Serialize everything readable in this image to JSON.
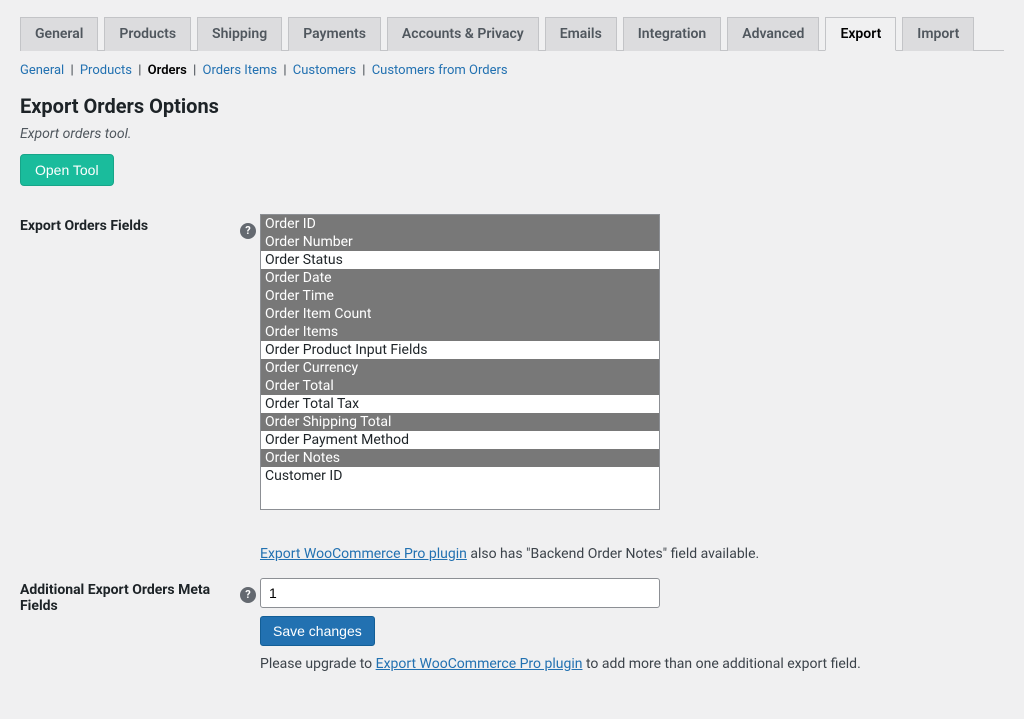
{
  "tabs": [
    {
      "label": "General"
    },
    {
      "label": "Products"
    },
    {
      "label": "Shipping"
    },
    {
      "label": "Payments"
    },
    {
      "label": "Accounts & Privacy"
    },
    {
      "label": "Emails"
    },
    {
      "label": "Integration"
    },
    {
      "label": "Advanced"
    },
    {
      "label": "Export",
      "active": true
    },
    {
      "label": "Import"
    }
  ],
  "subnav": {
    "items": [
      {
        "label": "General"
      },
      {
        "label": "Products"
      },
      {
        "label": "Orders",
        "current": true
      },
      {
        "label": "Orders Items"
      },
      {
        "label": "Customers"
      },
      {
        "label": "Customers from Orders"
      }
    ]
  },
  "heading": "Export Orders Options",
  "heading_desc": "Export orders tool.",
  "open_tool": "Open Tool",
  "fields": {
    "export_fields_label": "Export Orders Fields",
    "options": [
      {
        "label": "Order ID",
        "selected": true
      },
      {
        "label": "Order Number",
        "selected": true
      },
      {
        "label": "Order Status",
        "selected": false
      },
      {
        "label": "Order Date",
        "selected": true
      },
      {
        "label": "Order Time",
        "selected": true
      },
      {
        "label": "Order Item Count",
        "selected": true
      },
      {
        "label": "Order Items",
        "selected": true
      },
      {
        "label": "Order Product Input Fields",
        "selected": false
      },
      {
        "label": "Order Currency",
        "selected": true
      },
      {
        "label": "Order Total",
        "selected": true
      },
      {
        "label": "Order Total Tax",
        "selected": false
      },
      {
        "label": "Order Shipping Total",
        "selected": true
      },
      {
        "label": "Order Payment Method",
        "selected": false
      },
      {
        "label": "Order Notes",
        "selected": true
      },
      {
        "label": "Customer ID",
        "selected": false
      }
    ],
    "pro_note_link": "Export WooCommerce Pro plugin",
    "pro_note_after": " also has \"Backend Order Notes\" field available.",
    "meta_label": "Additional Export Orders Meta Fields",
    "meta_value": "1",
    "save_label": "Save changes",
    "upgrade_before": "Please upgrade to ",
    "upgrade_link": "Export WooCommerce Pro plugin",
    "upgrade_after": " to add more than one additional export field."
  }
}
